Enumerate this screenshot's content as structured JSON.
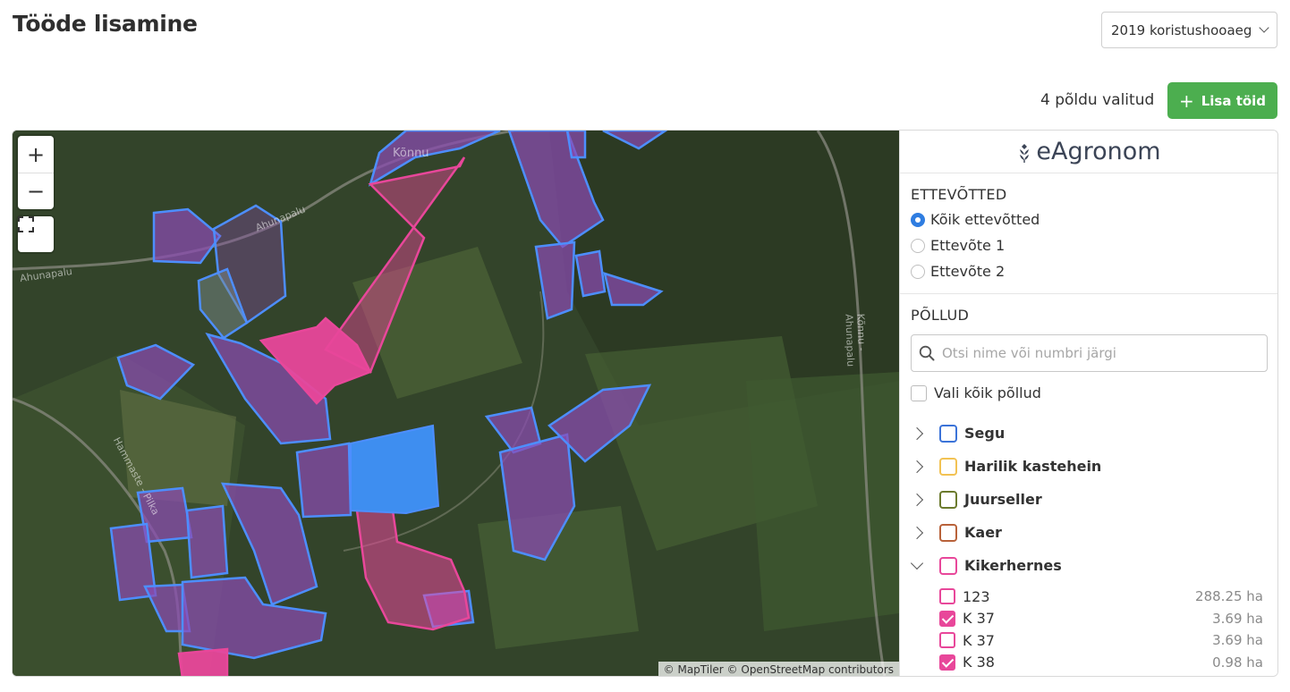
{
  "page": {
    "title": "Tööde lisamine"
  },
  "season_select": {
    "value": "2019 koristushooaeg"
  },
  "selection": {
    "count_text": "4 põldu valitud",
    "add_button_label": "Lisa töid"
  },
  "map": {
    "zoom_in": "+",
    "zoom_out": "−",
    "attribution": "© MapTiler © OpenStreetMap contributors",
    "labels": [
      "Kõnnu",
      "Ahunapalu",
      "Ahunapalu",
      "Kõnnu - Ahunapalu",
      "Hammaste - Pilka"
    ],
    "colors": {
      "field_fill": "#8a4bb3",
      "field_stroke": "#4d8eff",
      "selected_fill": "#e8479a",
      "highlight_fill": "#3e8ef0"
    }
  },
  "sidebar": {
    "logo_text": "eAgronom",
    "companies_title": "ETTEVÕTTED",
    "companies": [
      {
        "label": "Kõik ettevõtted",
        "selected": true
      },
      {
        "label": "Ettevõte 1",
        "selected": false
      },
      {
        "label": "Ettevõte 2",
        "selected": false
      }
    ],
    "fields_title": "PÕLLUD",
    "search_placeholder": "Otsi nime või numbri järgi",
    "select_all_label": "Vali kõik põllud",
    "crops": [
      {
        "name": "Segu",
        "color": "#3b73d8",
        "expanded": false
      },
      {
        "name": "Harilik kastehein",
        "color": "#f2c253",
        "expanded": false
      },
      {
        "name": "Juurseller",
        "color": "#6b7a2d",
        "expanded": false
      },
      {
        "name": "Kaer",
        "color": "#b8623a",
        "expanded": false
      },
      {
        "name": "Kikerhernes",
        "color": "#e8479a",
        "expanded": true
      }
    ],
    "fields": [
      {
        "name": "123",
        "area": "288.25 ha",
        "checked": false
      },
      {
        "name": "K 37",
        "area": "3.69 ha",
        "checked": true
      },
      {
        "name": "K 37",
        "area": "3.69 ha",
        "checked": false
      },
      {
        "name": "K 38",
        "area": "0.98 ha",
        "checked": true
      }
    ]
  }
}
